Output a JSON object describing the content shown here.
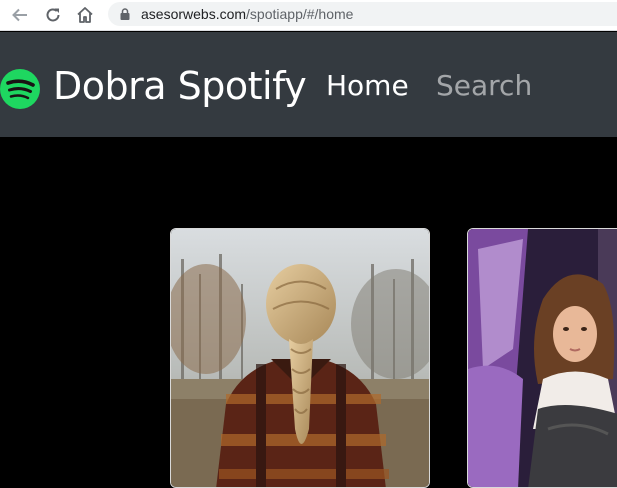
{
  "browser": {
    "url_domain": "asesorwebs.com",
    "url_path": "/spotiapp/#/home"
  },
  "navbar": {
    "brand": "Dobra Spotify",
    "links": [
      {
        "label": "Home",
        "active": true
      },
      {
        "label": "Search",
        "active": false
      }
    ]
  },
  "icons": {
    "back": "arrow-back-icon",
    "reload": "reload-icon",
    "home": "home-icon",
    "lock": "lock-icon",
    "logo": "spotify-logo-icon"
  },
  "colors": {
    "navbar_bg": "#343a40",
    "page_bg": "#000000",
    "spotify_green": "#1ed760",
    "link_active": "#ffffff",
    "link_muted": "rgba(255,255,255,0.55)"
  },
  "cards": [
    {
      "image": "album-cover-braid-plaid-coat"
    },
    {
      "image": "album-cover-portrait-purple-car"
    }
  ]
}
